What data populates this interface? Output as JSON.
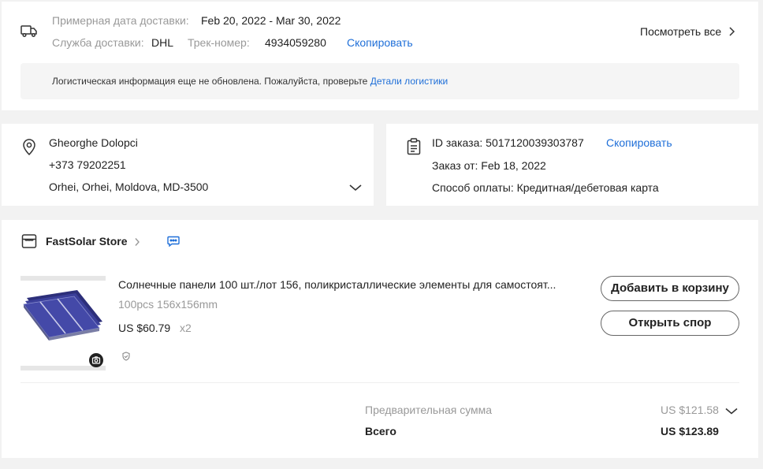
{
  "shipping": {
    "est_label": "Примерная дата доставки:",
    "est_value": "Feb 20, 2022 - Mar 30, 2022",
    "service_label": "Служба доставки:",
    "service_value": "DHL",
    "track_label": "Трек-номер:",
    "track_value": "4934059280",
    "copy_label": "Скопировать",
    "view_all": "Посмотреть все",
    "logistics_text": "Логистическая информация еще не обновлена. Пожалуйста, проверьте",
    "logistics_link": "Детали логистики"
  },
  "address": {
    "name": "Gheorghe Dolopci",
    "phone": "+373 79202251",
    "location": "Orhei, Orhei, Moldova, MD-3500"
  },
  "order": {
    "id_label": "ID заказа:",
    "id_value": "5017120039303787",
    "copy_label": "Скопировать",
    "date_label": "Заказ от:",
    "date_value": "Feb 18, 2022",
    "payment_label": "Способ оплаты:",
    "payment_value": "Кредитная/дебетовая карта"
  },
  "store": {
    "name": "FastSolar Store"
  },
  "product": {
    "title": "Солнечные панели 100 шт./лот 156, поликристаллические элементы для самостоят...",
    "variant": "100pcs 156x156mm",
    "price": "US $60.79",
    "quantity": "x2",
    "add_to_cart": "Добавить в корзину",
    "open_dispute": "Открыть спор"
  },
  "summary": {
    "subtotal_label": "Предварительная сумма",
    "subtotal_value": "US $121.58",
    "total_label": "Всего",
    "total_value": "US $123.89"
  },
  "colors": {
    "link": "#1f6fd8",
    "panel": "#3b3f9a",
    "background": "#f2f2f2"
  }
}
